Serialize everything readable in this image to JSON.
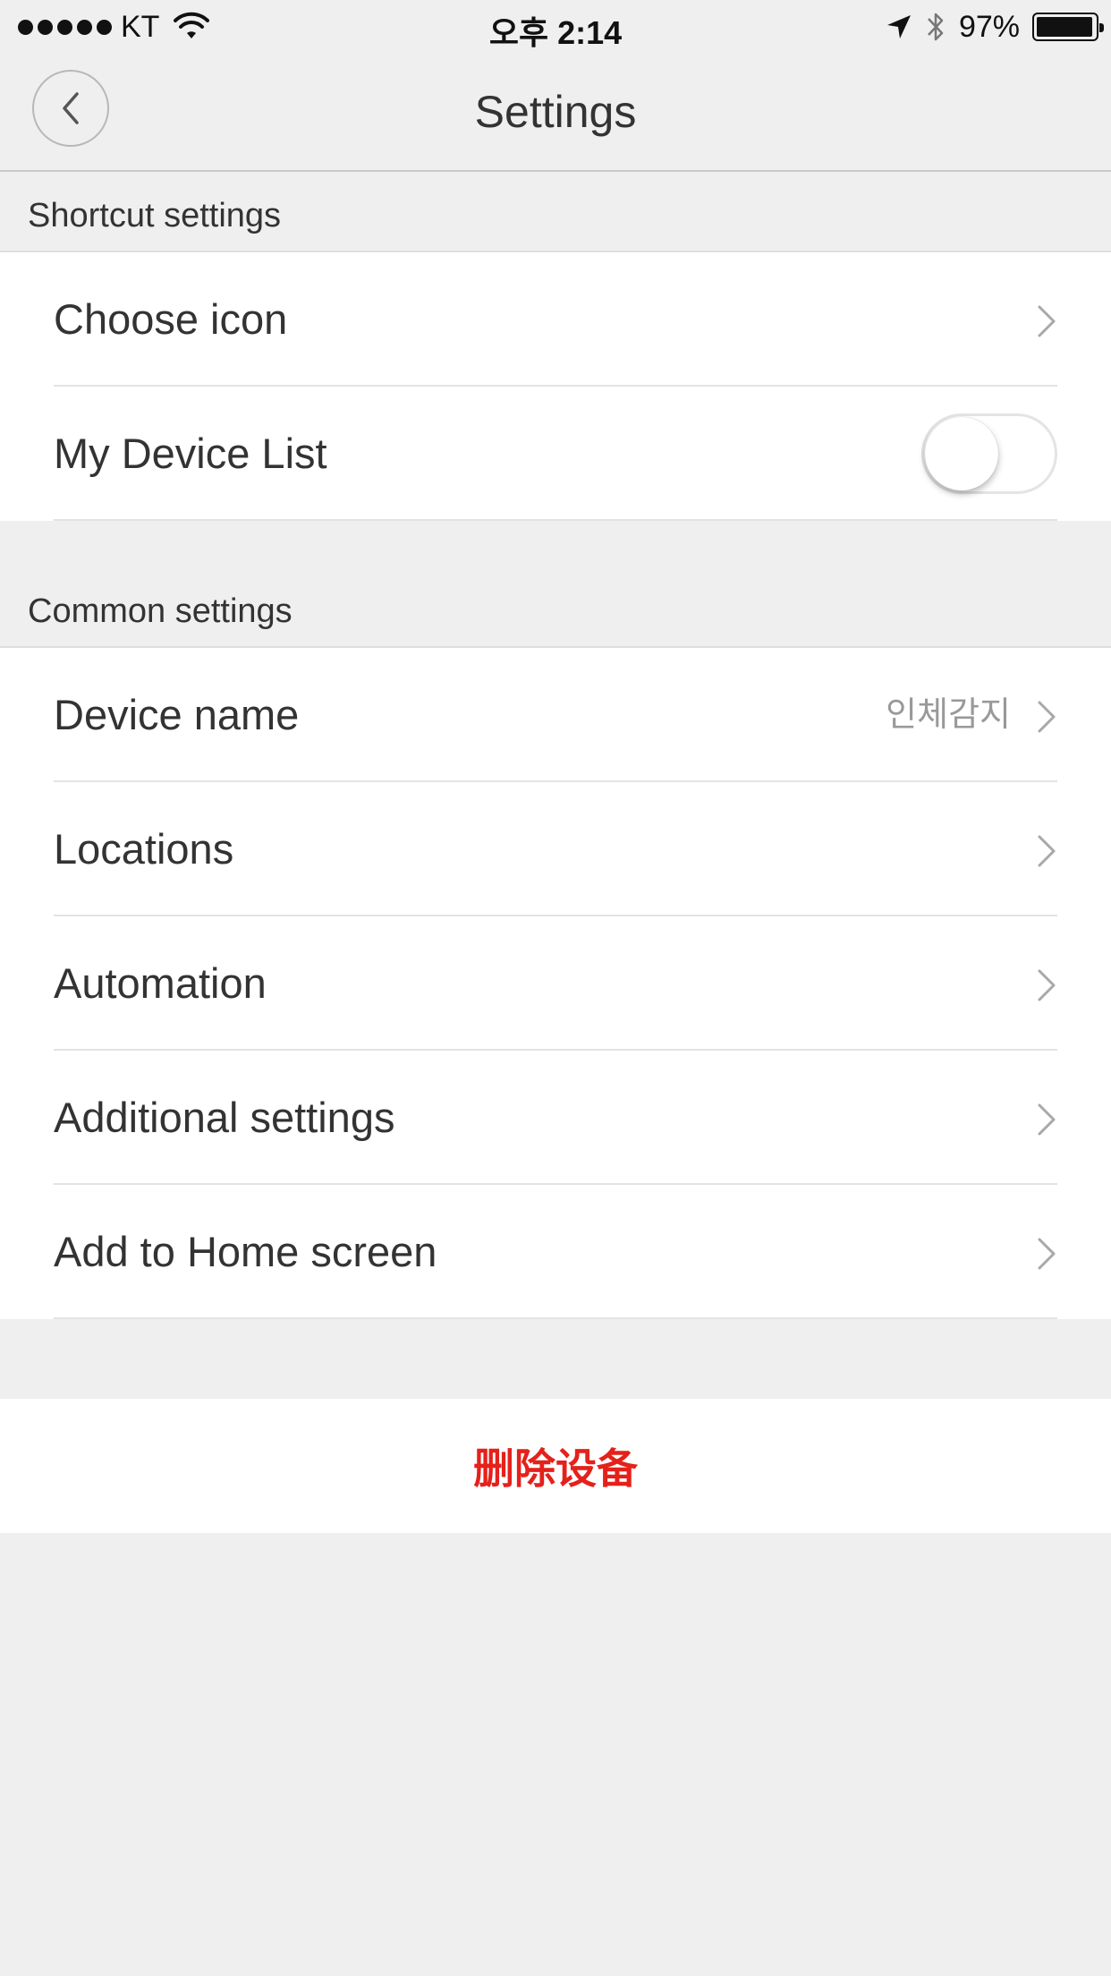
{
  "status_bar": {
    "carrier": "KT",
    "time": "오후 2:14",
    "battery_percent": "97%",
    "battery_level": 0.97,
    "icons": [
      "signal-dots-icon",
      "wifi-icon",
      "location-arrow-icon",
      "bluetooth-icon",
      "battery-icon"
    ]
  },
  "nav": {
    "title": "Settings",
    "back_icon": "chevron-left-icon"
  },
  "shortcut_section": {
    "header": "Shortcut settings",
    "rows": [
      {
        "label": "Choose icon",
        "control": "chevron-right-icon"
      },
      {
        "label": "My Device List",
        "control": "toggle",
        "toggle_on": false
      }
    ]
  },
  "common_section": {
    "header": "Common settings",
    "rows": [
      {
        "label": "Device name",
        "value": "인체감지",
        "control": "chevron-right-icon"
      },
      {
        "label": "Locations",
        "control": "chevron-right-icon"
      },
      {
        "label": "Automation",
        "control": "chevron-right-icon"
      },
      {
        "label": "Additional settings",
        "control": "chevron-right-icon"
      },
      {
        "label": "Add to Home screen",
        "control": "chevron-right-icon"
      }
    ]
  },
  "delete_button": {
    "label": "删除设备",
    "color": "#e4211b"
  },
  "colors": {
    "background": "#efefef",
    "card": "#ffffff",
    "text": "#333333",
    "secondary_text": "#999999",
    "danger": "#e4211b"
  }
}
